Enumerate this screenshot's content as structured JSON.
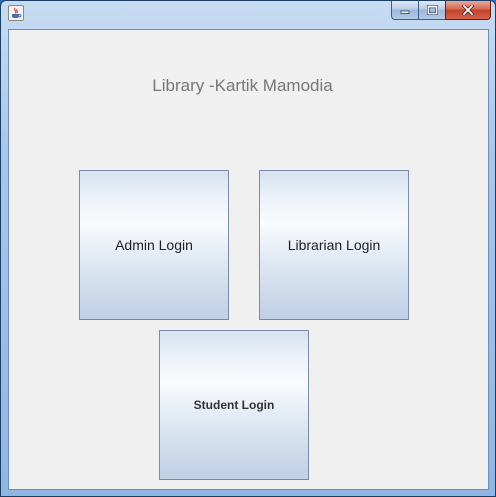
{
  "window": {
    "app_icon": "java-coffee-icon",
    "controls": {
      "minimize_icon": "minimize-icon",
      "maximize_icon": "maximize-icon",
      "close_icon": "close-icon"
    }
  },
  "main": {
    "heading": "Library -Kartik Mamodia",
    "buttons": {
      "admin": "Admin Login",
      "librarian": "Librarian Login",
      "student": "Student Login"
    }
  },
  "colors": {
    "client_bg": "#f0f0f0",
    "heading_text": "#777777",
    "button_border": "#7a8aa6",
    "close_button": "#c3412a"
  }
}
